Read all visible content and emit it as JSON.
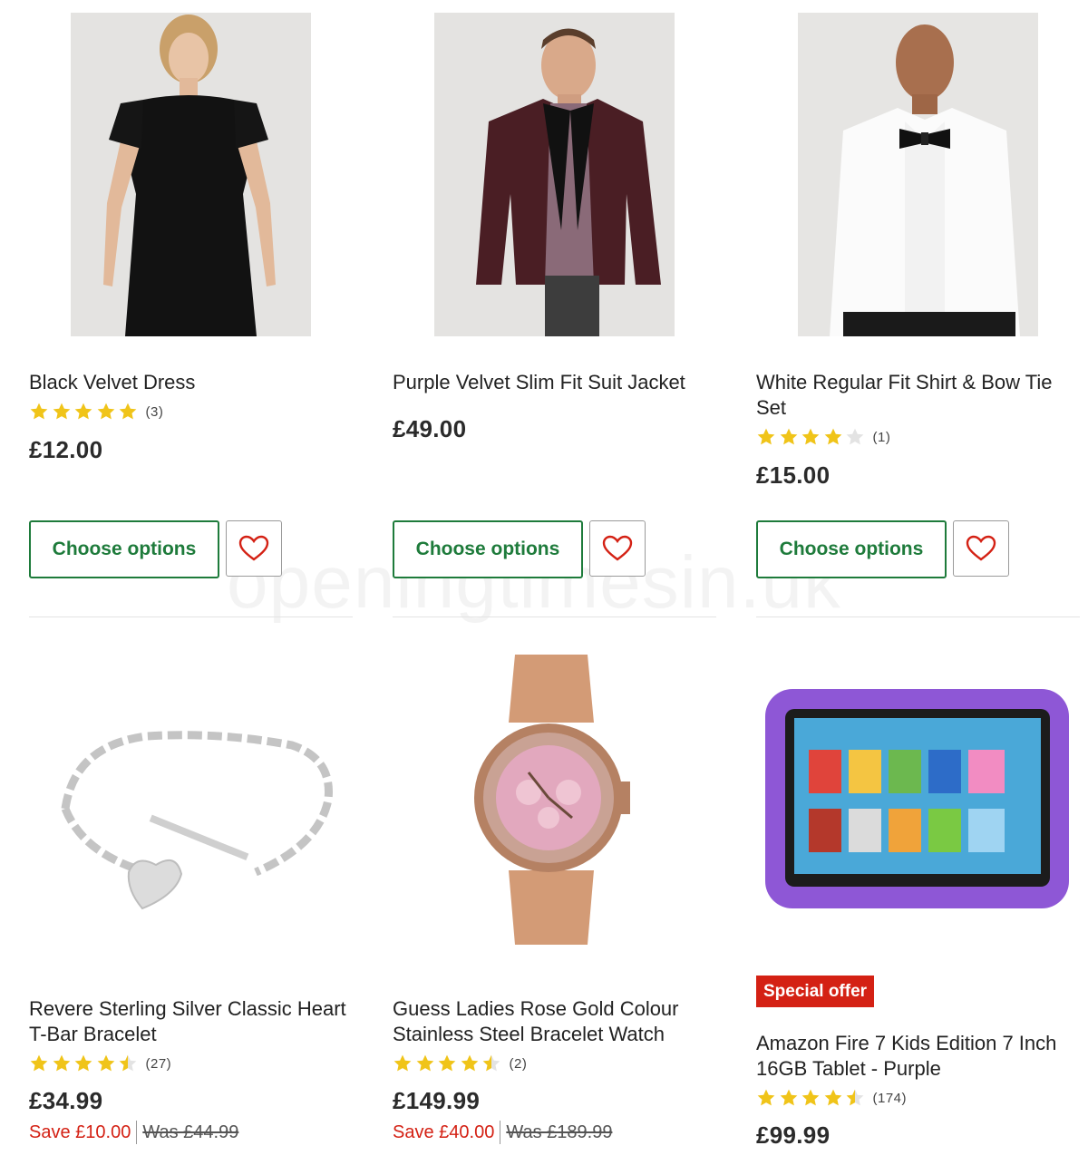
{
  "watermark": "openingtimesin.uk",
  "colors": {
    "accent_green": "#1e7b3b",
    "sale_red": "#d42114",
    "star_gold": "#f0c419"
  },
  "choose_label": "Choose options",
  "products": [
    {
      "title": "Black Velvet Dress",
      "rating": 5,
      "reviews": "(3)",
      "price": "£12.00"
    },
    {
      "title": "Purple Velvet Slim Fit Suit Jacket",
      "price": "£49.00"
    },
    {
      "title": "White Regular Fit Shirt & Bow Tie Set",
      "rating": 4,
      "reviews": "(1)",
      "price": "£15.00"
    },
    {
      "title": "Revere Sterling Silver Classic Heart T-Bar Bracelet",
      "rating": 4.5,
      "reviews": "(27)",
      "price": "£34.99",
      "save": "Save £10.00",
      "was": "Was £44.99"
    },
    {
      "title": "Guess Ladies Rose Gold Colour Stainless Steel Bracelet Watch",
      "rating": 4.5,
      "reviews": "(2)",
      "price": "£149.99",
      "save": "Save £40.00",
      "was": "Was £189.99"
    },
    {
      "badge": "Special offer",
      "title": "Amazon Fire 7 Kids Edition 7 Inch 16GB Tablet - Purple",
      "rating": 4.5,
      "reviews": "(174)",
      "price": "£99.99"
    }
  ]
}
